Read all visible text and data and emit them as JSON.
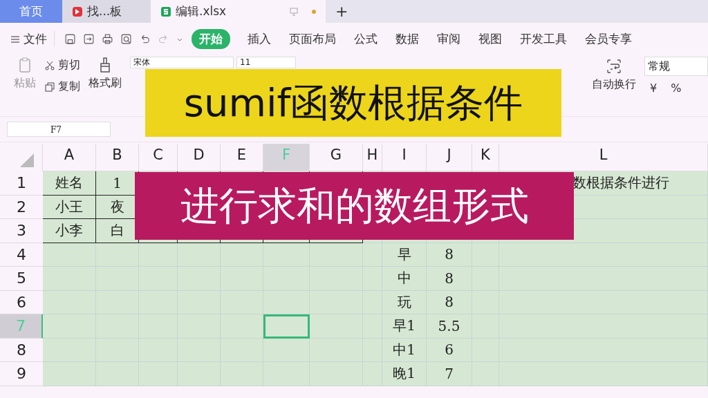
{
  "tabs": [
    {
      "label": "首页",
      "kind": "home",
      "selected": false
    },
    {
      "label": "找...板",
      "kind": "doc",
      "selected": false
    },
    {
      "label": "编辑.xlsx",
      "kind": "sheet",
      "selected": true
    }
  ],
  "new_tab": "+",
  "menu": {
    "file": "文件",
    "items": [
      {
        "label": "开始",
        "selected": true
      },
      {
        "label": "插入",
        "selected": false
      },
      {
        "label": "页面布局",
        "selected": false
      },
      {
        "label": "公式",
        "selected": false
      },
      {
        "label": "数据",
        "selected": false
      },
      {
        "label": "审阅",
        "selected": false
      },
      {
        "label": "视图",
        "selected": false
      },
      {
        "label": "开发工具",
        "selected": false
      },
      {
        "label": "会员专享",
        "selected": false
      }
    ]
  },
  "ribbon": {
    "paste": "粘贴",
    "cut": "剪切",
    "copy": "复制",
    "format_painter": "格式刷",
    "font": "宋体",
    "font_size": "11",
    "wrap": "自动换行",
    "number_format": "常规",
    "currency": "¥",
    "percent": "%"
  },
  "name_box": "F7",
  "sheet": {
    "columns": [
      {
        "label": "A",
        "selected": false
      },
      {
        "label": "B",
        "selected": false
      },
      {
        "label": "C",
        "selected": false
      },
      {
        "label": "D",
        "selected": false
      },
      {
        "label": "E",
        "selected": false
      },
      {
        "label": "F",
        "selected": true
      },
      {
        "label": "G",
        "selected": false
      },
      {
        "label": "H",
        "selected": false
      },
      {
        "label": "I",
        "selected": false
      },
      {
        "label": "J",
        "selected": false
      },
      {
        "label": "K",
        "selected": false
      },
      {
        "label": "L",
        "selected": false
      }
    ],
    "rows": [
      {
        "label": "1",
        "selected": false,
        "cells": {
          "A": "姓名",
          "B": "1",
          "L": "数根据条件进行"
        }
      },
      {
        "label": "2",
        "selected": false,
        "cells": {
          "A": "小王",
          "B": "夜"
        }
      },
      {
        "label": "3",
        "selected": false,
        "cells": {
          "A": "小李",
          "B": "白"
        }
      },
      {
        "label": "4",
        "selected": false,
        "cells": {
          "I": "早",
          "J": "8"
        }
      },
      {
        "label": "5",
        "selected": false,
        "cells": {
          "I": "中",
          "J": "8"
        }
      },
      {
        "label": "6",
        "selected": false,
        "cells": {
          "I": "玩",
          "J": "8"
        }
      },
      {
        "label": "7",
        "selected": true,
        "cells": {
          "I": "早1",
          "J": "5.5"
        }
      },
      {
        "label": "8",
        "selected": false,
        "cells": {
          "I": "中1",
          "J": "6"
        }
      },
      {
        "label": "9",
        "selected": false,
        "cells": {
          "I": "晚1",
          "J": "7"
        }
      }
    ]
  },
  "captions": [
    {
      "text": "sumif函数根据条件",
      "kind": "yellow"
    },
    {
      "text": "进行求和的数组形式",
      "kind": "magenta"
    }
  ]
}
